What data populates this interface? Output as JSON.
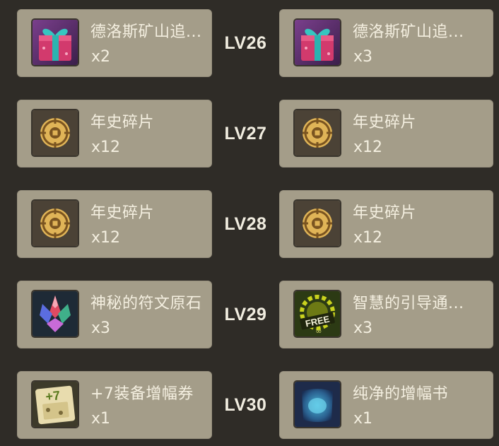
{
  "rows": [
    {
      "level": "LV26",
      "left": {
        "name": "德洛斯矿山追...",
        "qty": "x2",
        "icon": "gift-box-icon"
      },
      "right": {
        "name": "德洛斯矿山追...",
        "qty": "x3",
        "icon": "gift-box-icon"
      }
    },
    {
      "level": "LV27",
      "left": {
        "name": "年史碎片",
        "qty": "x12",
        "icon": "chronicle-coin-icon"
      },
      "right": {
        "name": "年史碎片",
        "qty": "x12",
        "icon": "chronicle-coin-icon"
      }
    },
    {
      "level": "LV28",
      "left": {
        "name": "年史碎片",
        "qty": "x12",
        "icon": "chronicle-coin-icon"
      },
      "right": {
        "name": "年史碎片",
        "qty": "x12",
        "icon": "chronicle-coin-icon"
      }
    },
    {
      "level": "LV29",
      "left": {
        "name": "神秘的符文原石",
        "qty": "x3",
        "icon": "rune-crystal-icon"
      },
      "right": {
        "name": "智慧的引导通...",
        "qty": "x3",
        "icon": "free-gear-ticket-icon"
      }
    },
    {
      "level": "LV30",
      "left": {
        "name": "+7装备增幅券",
        "qty": "x1",
        "icon": "amplify-ticket-icon"
      },
      "right": {
        "name": "纯净的增幅书",
        "qty": "x1",
        "icon": "amplify-book-icon"
      }
    }
  ],
  "icon_texts": {
    "free": "FREE",
    "plus7": "+7"
  },
  "colors": {
    "background": "#2f2c27",
    "card": "#a49d89",
    "text": "#f4efe0"
  }
}
